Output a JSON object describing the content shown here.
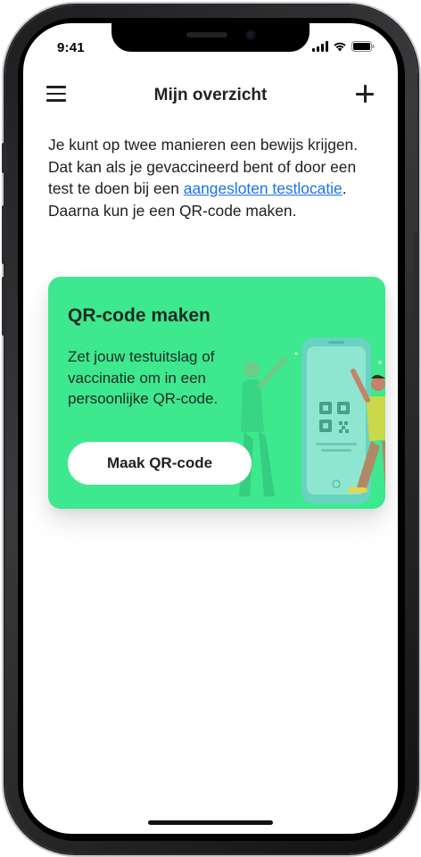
{
  "status_bar": {
    "time": "9:41"
  },
  "header": {
    "title": "Mijn overzicht",
    "menu_icon": "hamburger-menu-icon",
    "add_icon": "plus-icon"
  },
  "intro": {
    "text_before_link": "Je kunt op twee manieren een bewijs krijgen. Dat kan als je gevaccineerd bent of door een test te doen bij een ",
    "link_text": "aangesloten testlocatie",
    "text_after_link": ". Daarna kun je een QR-code maken."
  },
  "card": {
    "title": "QR-code maken",
    "body": "Zet jouw testuitslag of vaccinatie om in een persoonlijke QR-code.",
    "button_label": "Maak QR-code",
    "illustration": "phone-qr-illustration"
  },
  "colors": {
    "card_background": "#3ee88f",
    "link": "#1a73e8",
    "text": "#1f1f1f"
  }
}
